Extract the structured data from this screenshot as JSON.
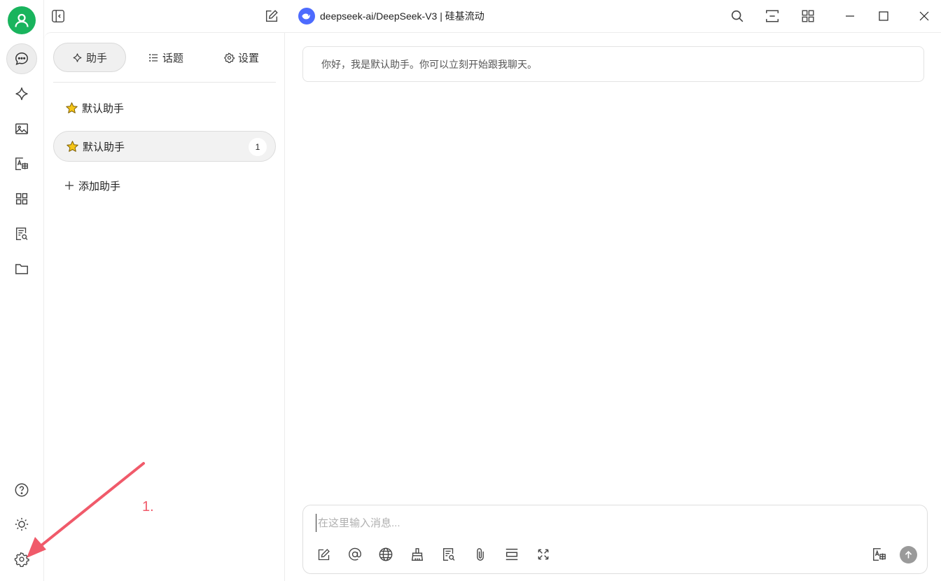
{
  "titlebar": {
    "model_name": "deepseek-ai/DeepSeek-V3 | 硅基流动"
  },
  "tabs": [
    {
      "label": "助手",
      "icon": "sparkle-icon",
      "active": true
    },
    {
      "label": "话题",
      "icon": "list-icon",
      "active": false
    },
    {
      "label": "设置",
      "icon": "gear-icon",
      "active": false
    }
  ],
  "assistants": [
    {
      "label": "默认助手",
      "icon": "star-emoji",
      "active": false,
      "badge": ""
    },
    {
      "label": "默认助手",
      "icon": "star-emoji",
      "active": true,
      "badge": "1"
    }
  ],
  "add_assistant_label": "添加助手",
  "chat": {
    "welcome": "你好，我是默认助手。你可以立刻开始跟我聊天。",
    "input_placeholder": "在这里输入消息..."
  },
  "annotation": {
    "label": "1.",
    "color": "#f05a6a"
  },
  "colors": {
    "avatar": "#19b45d",
    "model_logo": "#4d6bfe",
    "star": "#f5c518"
  }
}
